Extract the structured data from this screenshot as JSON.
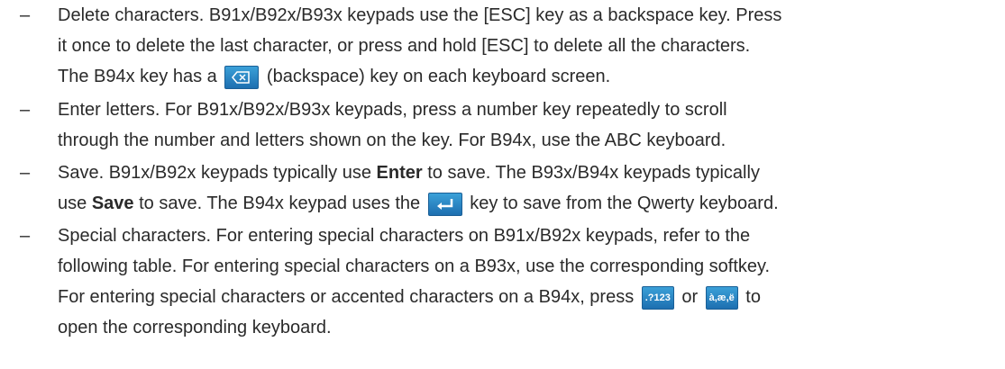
{
  "items": [
    {
      "dash": "–",
      "l1": "Delete characters. B91x/B92x/B93x keypads use the [ESC] key as a backspace key. Press",
      "l2": "it once to delete the last character, or press and hold [ESC] to delete all the characters.",
      "l3a": "The B94x key has a",
      "l3b": "(backspace) key on each keyboard screen."
    },
    {
      "dash": "–",
      "l1": "Enter letters. For B91x/B92x/B93x keypads, press a number key repeatedly to scroll",
      "l2": "through the number and letters shown on the key. For B94x, use the ABC keyboard."
    },
    {
      "dash": "–",
      "l1a": "Save. B91x/B92x keypads typically use",
      "l1b": "Enter",
      "l1c": "to save. The B93x/B94x keypads typically",
      "l2a": "use",
      "l2b": "Save",
      "l2c": "to save. The B94x keypad uses the",
      "l2d": "key to save from the Qwerty keyboard."
    },
    {
      "dash": "–",
      "l1": "Special characters. For entering special characters on B91x/B92x keypads, refer to the",
      "l2": "following table. For entering special characters on a B93x, use the corresponding softkey.",
      "l3a": "For entering special characters or accented characters on a B94x, press",
      "l3b": "or",
      "l3c": "to",
      "l4": "open the corresponding keyboard."
    }
  ],
  "keys": {
    "backspace_icon": "backspace-icon",
    "enter_icon": "enter-icon",
    "symbols_label": ".?123",
    "accents_label": "à,æ,ë"
  }
}
